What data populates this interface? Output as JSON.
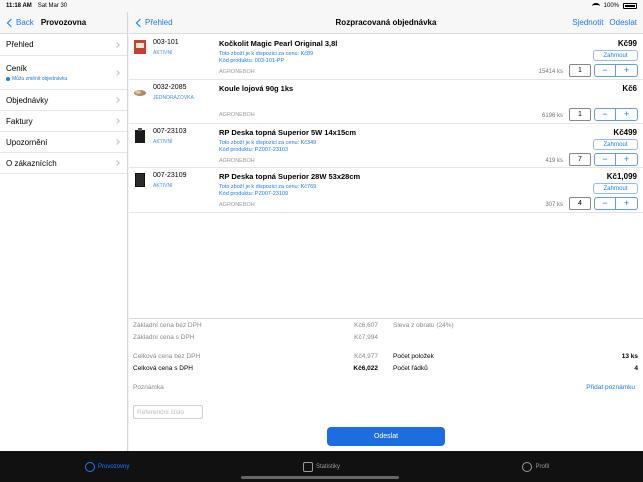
{
  "status_bar": {
    "time": "11:18 AM",
    "date": "Sat Mar 30",
    "battery": "100%"
  },
  "sidebar": {
    "back_label": "Back",
    "title": "Provozovna",
    "items": [
      {
        "label": "Přehled"
      },
      {
        "label": "Ceník",
        "note": "Můžu změnit objednávku"
      },
      {
        "label": "Objednávky"
      },
      {
        "label": "Faktury"
      },
      {
        "label": "Upozornění"
      },
      {
        "label": "O zákaznících"
      }
    ]
  },
  "main": {
    "back_label": "Přehled",
    "title": "Rozpracovaná objednávka",
    "action_merge": "Sjednotit",
    "action_send": "Odeslat"
  },
  "products": [
    {
      "code": "003-101",
      "status": "AKTIVNÍ",
      "name": "Kočkolit Magic Pearl Original 3,8l",
      "avail_line": "Toto zboží je k dispozici za cenu: Kč89",
      "product_code_line": "Kód produktu: 003-101-PP",
      "vendor": "AGRONEBOH",
      "price": "Kč99",
      "return_label": "Zahrnout",
      "stock": "15414 ks",
      "qty": "1"
    },
    {
      "code": "0032-2085",
      "status": "JEDNORÁZOVKA",
      "name": "Koule lojová 90g 1ks",
      "avail_line": "",
      "product_code_line": "",
      "vendor": "AGRONEBOH",
      "price": "Kč6",
      "return_label": "",
      "stock": "6196 ks",
      "qty": "1"
    },
    {
      "code": "007-23103",
      "status": "AKTIVNÍ",
      "name": "RP Deska topná Superior 5W 14x15cm",
      "avail_line": "Toto zboží je k dispozici za cenu: Kč349",
      "product_code_line": "Kód produktu: PZ007-23103",
      "vendor": "AGRONEBOH",
      "price": "Kč499",
      "return_label": "Zahrnout",
      "stock": "419 ks",
      "qty": "7"
    },
    {
      "code": "007-23109",
      "status": "AKTIVNÍ",
      "name": "RP Deska topná Superior 28W 53x28cm",
      "avail_line": "Toto zboží je k dispozici za cenu: Kč769",
      "product_code_line": "Kód produktu: PZ007-23109",
      "vendor": "AGRONEBOH",
      "price": "Kč1,099",
      "return_label": "Zahrnout",
      "stock": "307 ks",
      "qty": "4"
    }
  ],
  "summary": {
    "base_net_label": "Základní cena bez DPH",
    "base_net_value": "Kč6,607",
    "base_gross_label": "Základní cena s DPH",
    "base_gross_value": "Kč7,994",
    "discount_label": "Sleva z obratu (24%)",
    "total_net_label": "Celková cena bez DPH",
    "total_net_value": "Kč4,977",
    "total_gross_label": "Celková cena s DPH",
    "total_gross_value": "Kč6,022",
    "items_count_label": "Počet položek",
    "items_count_value": "13 ks",
    "rows_count_label": "Počet řádků",
    "rows_count_value": "4",
    "note_label": "Poznámka",
    "add_note_label": "Přidat poznámku",
    "reference_placeholder": "Referenční číslo",
    "send_label": "Odeslat"
  },
  "tabbar": [
    {
      "label": "Provozovny",
      "icon": "store-icon",
      "active": true
    },
    {
      "label": "Statistiky",
      "icon": "stats-icon",
      "active": false
    },
    {
      "label": "Profil",
      "icon": "profile-icon",
      "active": false
    }
  ],
  "colors": {
    "accent": "#1c7bff",
    "button": "#1c6de0",
    "tabbar": "#111111"
  }
}
